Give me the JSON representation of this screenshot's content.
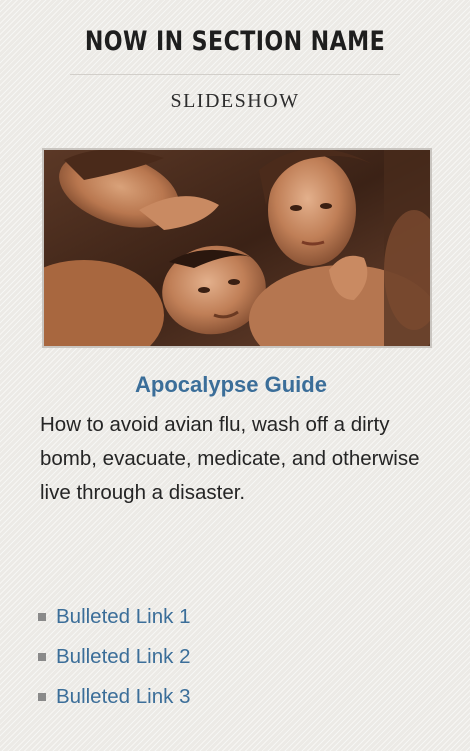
{
  "section": {
    "title": "NOW IN SECTION NAME",
    "kicker": "SLIDESHOW"
  },
  "feature": {
    "image_icon": "slideshow-photo",
    "headline": "Apocalypse Guide",
    "dek": "How to avoid avian flu, wash off a dirty bomb, evacuate, medicate, and otherwise live through a disaster."
  },
  "links": [
    {
      "label": "Bulleted Link 1"
    },
    {
      "label": "Bulleted Link 2"
    },
    {
      "label": "Bulleted Link 3"
    }
  ],
  "colors": {
    "link": "#3b6e99",
    "title": "#1e1e1e",
    "body_text": "#252525",
    "background": "#eceae6"
  }
}
